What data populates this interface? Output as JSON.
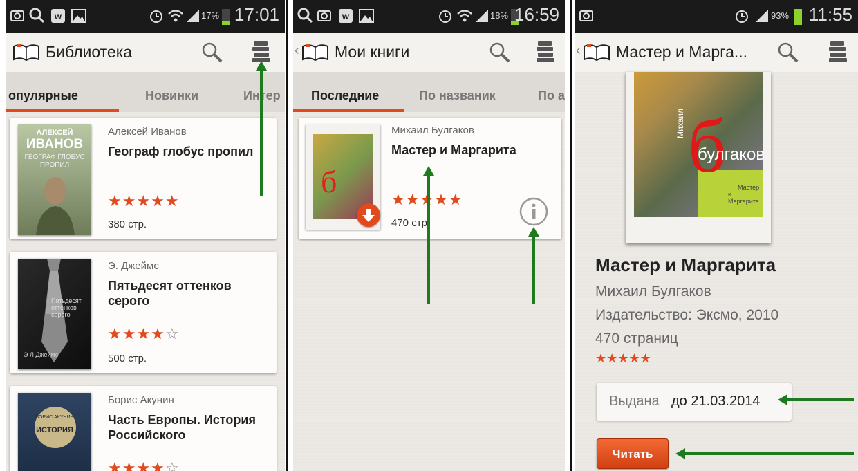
{
  "colors": {
    "accent": "#e2491c",
    "arrow": "#1e7a1e",
    "tab_bg": "#dedbd6",
    "actionbar_bg": "#f4f2ee"
  },
  "screen1": {
    "status": {
      "time": "17:01",
      "battery": "17%"
    },
    "title": "Библиотека",
    "tabs": [
      "опулярные",
      "Новинки",
      "Интер"
    ],
    "books": [
      {
        "author": "Алексей Иванов",
        "title": "Географ глобус пропил",
        "rating": 5,
        "stars": "★★★★★",
        "pages": "380 стр.",
        "cover_text": {
          "top": "АЛЕКСЕЙ",
          "big": "ИВАНОВ",
          "mid": "ГЕОГРАФ ГЛОБУС ПРОПИЛ"
        }
      },
      {
        "author": "Э. Джеймс",
        "title": "Пятьдесят оттенков серого",
        "rating": 4,
        "stars": "★★★★",
        "empty_stars": "☆",
        "pages": "500 стр.",
        "cover_text": {
          "mid": "Пятьдесят оттенков серого",
          "bottom": "Э Л Джеймс"
        }
      },
      {
        "author": "Борис Акунин",
        "title": "Часть Европы. История Российского",
        "rating": 4,
        "stars": "★★★★",
        "empty_stars": "☆",
        "cover_text": {
          "top": "БОРИС АКУНИН",
          "big": "ИСТОРИЯ"
        }
      }
    ]
  },
  "screen2": {
    "status": {
      "time": "16:59",
      "battery": "18%"
    },
    "title": "Мои книги",
    "tabs": [
      "Последние",
      "По названик",
      "По а"
    ],
    "book": {
      "author": "Михаил Булгаков",
      "title": "Мастер и Маргарита",
      "rating": 5,
      "stars": "★★★★★",
      "pages": "470 стр."
    }
  },
  "screen3": {
    "status": {
      "time": "11:55",
      "battery": "93%"
    },
    "title": "Мастер и Марга...",
    "book": {
      "title": "Мастер и Маргарита",
      "author": "Михаил Булгаков",
      "publisher": "Издательство: Эксмо, 2010",
      "pages": "470 страниц",
      "rating": 5,
      "stars": "★★★★★",
      "cover_text": {
        "letter": "б",
        "name": "булгаков",
        "vertical": "Михаил",
        "sub1": "Мастер",
        "sub2": "и Маргарита"
      }
    },
    "issued_label": "Выдана",
    "issued_until": "до 21.03.2014",
    "read_button": "Читать"
  }
}
